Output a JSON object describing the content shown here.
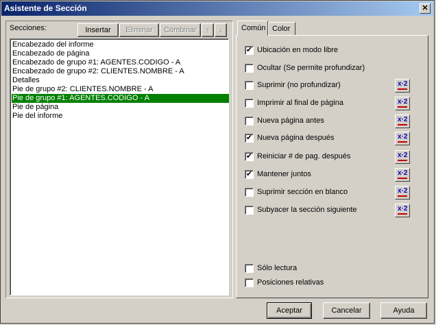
{
  "window": {
    "title": "Asistente de Sección",
    "close": "✕"
  },
  "sections": {
    "label": "Secciones:",
    "buttons": {
      "insert": "Insertar",
      "delete": "Eliminar",
      "merge": "Combinar",
      "up": "↑",
      "down": "↓"
    },
    "items": [
      "Encabezado del informe",
      "Encabezado de página",
      "Encabezado de grupo #1: AGENTES.CODIGO - A",
      "Encabezado de grupo #2: CLIENTES.NOMBRE - A",
      "Detalles",
      "Pie de grupo #2: CLIENTES.NOMBRE - A",
      "Pie de grupo #1: AGENTES.CODIGO - A",
      "Pie de página",
      "Pie del informe"
    ],
    "selected_index": 6
  },
  "tabs": [
    {
      "label": "Común"
    },
    {
      "label": "Color"
    }
  ],
  "options": [
    {
      "label": "Ubicación en modo libre",
      "checked": true,
      "formula": false
    },
    {
      "label": "Ocultar (Se permite profundizar)",
      "checked": false,
      "formula": false
    },
    {
      "label": "Suprimir (no profundizar)",
      "checked": false,
      "formula": true
    },
    {
      "label": "Imprimir al final de página",
      "checked": false,
      "formula": true
    },
    {
      "label": "Nueva página antes",
      "checked": false,
      "formula": true
    },
    {
      "label": "Nueva página después",
      "checked": true,
      "formula": true
    },
    {
      "label": "Reiniciar # de pag. después",
      "checked": true,
      "formula": true
    },
    {
      "label": "Mantener juntos",
      "checked": true,
      "formula": true
    },
    {
      "label": "Suprimir sección en blanco",
      "checked": false,
      "formula": true
    },
    {
      "label": "Subyacer la sección siguiente",
      "checked": false,
      "formula": true
    }
  ],
  "bottom_options": [
    {
      "label": "Sólo lectura",
      "checked": false
    },
    {
      "label": "Posiciones relativas",
      "checked": false
    }
  ],
  "formula_icon_text": "x·2",
  "footer": {
    "accept": "Aceptar",
    "cancel": "Cancelar",
    "help": "Ayuda"
  }
}
